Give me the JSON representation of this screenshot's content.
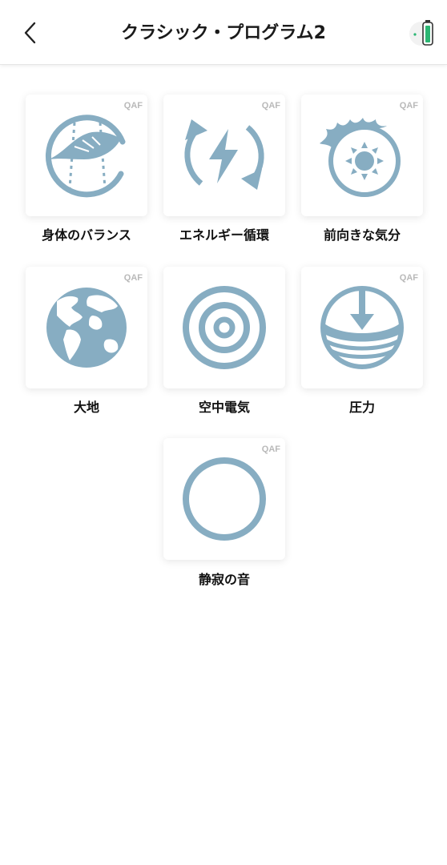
{
  "header": {
    "title": "クラシック・プログラム2",
    "back_icon": "chevron-left-icon",
    "battery_icon": "battery-icon",
    "battery_color": "#2bb673"
  },
  "programs": [
    {
      "label": "身体のバランス",
      "badge": "QAF",
      "icon": "leaf-balance-icon"
    },
    {
      "label": "エネルギー循環",
      "badge": "QAF",
      "icon": "lightning-cycle-icon"
    },
    {
      "label": "前向きな気分",
      "badge": "QAF",
      "icon": "sun-mood-icon"
    },
    {
      "label": "大地",
      "badge": "QAF",
      "icon": "globe-icon"
    },
    {
      "label": "空中電気",
      "badge": "",
      "icon": "target-icon"
    },
    {
      "label": "圧力",
      "badge": "QAF",
      "icon": "pressure-icon"
    },
    {
      "label": "静寂の音",
      "badge": "QAF",
      "icon": "circle-icon"
    }
  ],
  "colors": {
    "icon": "#87adc2",
    "background": "#ffffff",
    "badge": "#b9b9b9"
  }
}
